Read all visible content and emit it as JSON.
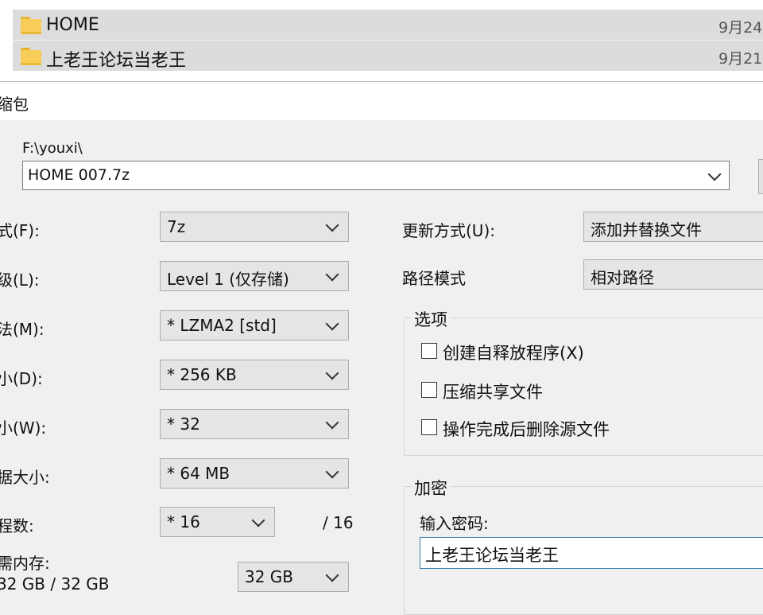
{
  "files": [
    {
      "name": "HOME",
      "date": "9月24"
    },
    {
      "name": "上老王论坛当老王",
      "date": "9月21"
    }
  ],
  "dialog": {
    "title_partial": "缩包"
  },
  "archive": {
    "label_partial": ")",
    "path": "F:\\youxi\\",
    "name": "HOME 007.7z"
  },
  "left": {
    "format": {
      "label_partial": "式(F):",
      "value": "7z"
    },
    "level": {
      "label_partial": "级(L):",
      "value": "Level 1 (仅存储)"
    },
    "method": {
      "label_partial": "法(M):",
      "value": "* LZMA2 [std]"
    },
    "dict": {
      "label_partial": "小(D):",
      "value": "* 256 KB"
    },
    "word": {
      "label_partial": "小(W):",
      "value": "* 32"
    },
    "solid": {
      "label_partial": "据大小:",
      "value": "* 64 MB"
    },
    "threads": {
      "label_partial": "程数:",
      "value": "* 16",
      "max": "/ 16"
    },
    "memory": {
      "label_partial": "需内存:",
      "usage": "32 GB / 32 GB",
      "value": "32 GB"
    }
  },
  "right": {
    "update_mode": {
      "label": "更新方式(U):",
      "value": "添加并替换文件"
    },
    "path_mode": {
      "label": "路径模式",
      "value": "相对路径"
    },
    "options": {
      "title": "选项",
      "items": [
        "创建自释放程序(X)",
        "压缩共享文件",
        "操作完成后删除源文件"
      ]
    },
    "encryption": {
      "title": "加密",
      "password_label": "输入密码:",
      "password_value": "上老王论坛当老王"
    }
  },
  "colors": {
    "folder": "#f7cd57",
    "selection": "#dcdcdc",
    "focus_border": "#3c7fb1"
  }
}
